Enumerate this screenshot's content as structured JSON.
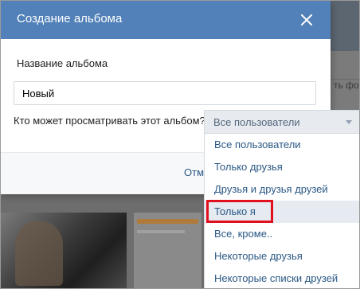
{
  "background": {
    "side_text": "ть фото"
  },
  "modal": {
    "title": "Создание альбома",
    "name_label": "Название альбома",
    "name_value": "Новый",
    "privacy_label": "Кто может просматривать этот альбом?",
    "cancel_label": "Отмена"
  },
  "privacy_select": {
    "selected": "Все пользователи",
    "options": [
      "Все пользователи",
      "Только друзья",
      "Друзья и друзья друзей",
      "Только я",
      "Все, кроме..",
      "Некоторые друзья",
      "Некоторые списки друзей"
    ],
    "hovered_option": "Только я"
  },
  "colors": {
    "header": "#5181b8",
    "link": "#2a5885",
    "highlight": "#e0101c"
  }
}
